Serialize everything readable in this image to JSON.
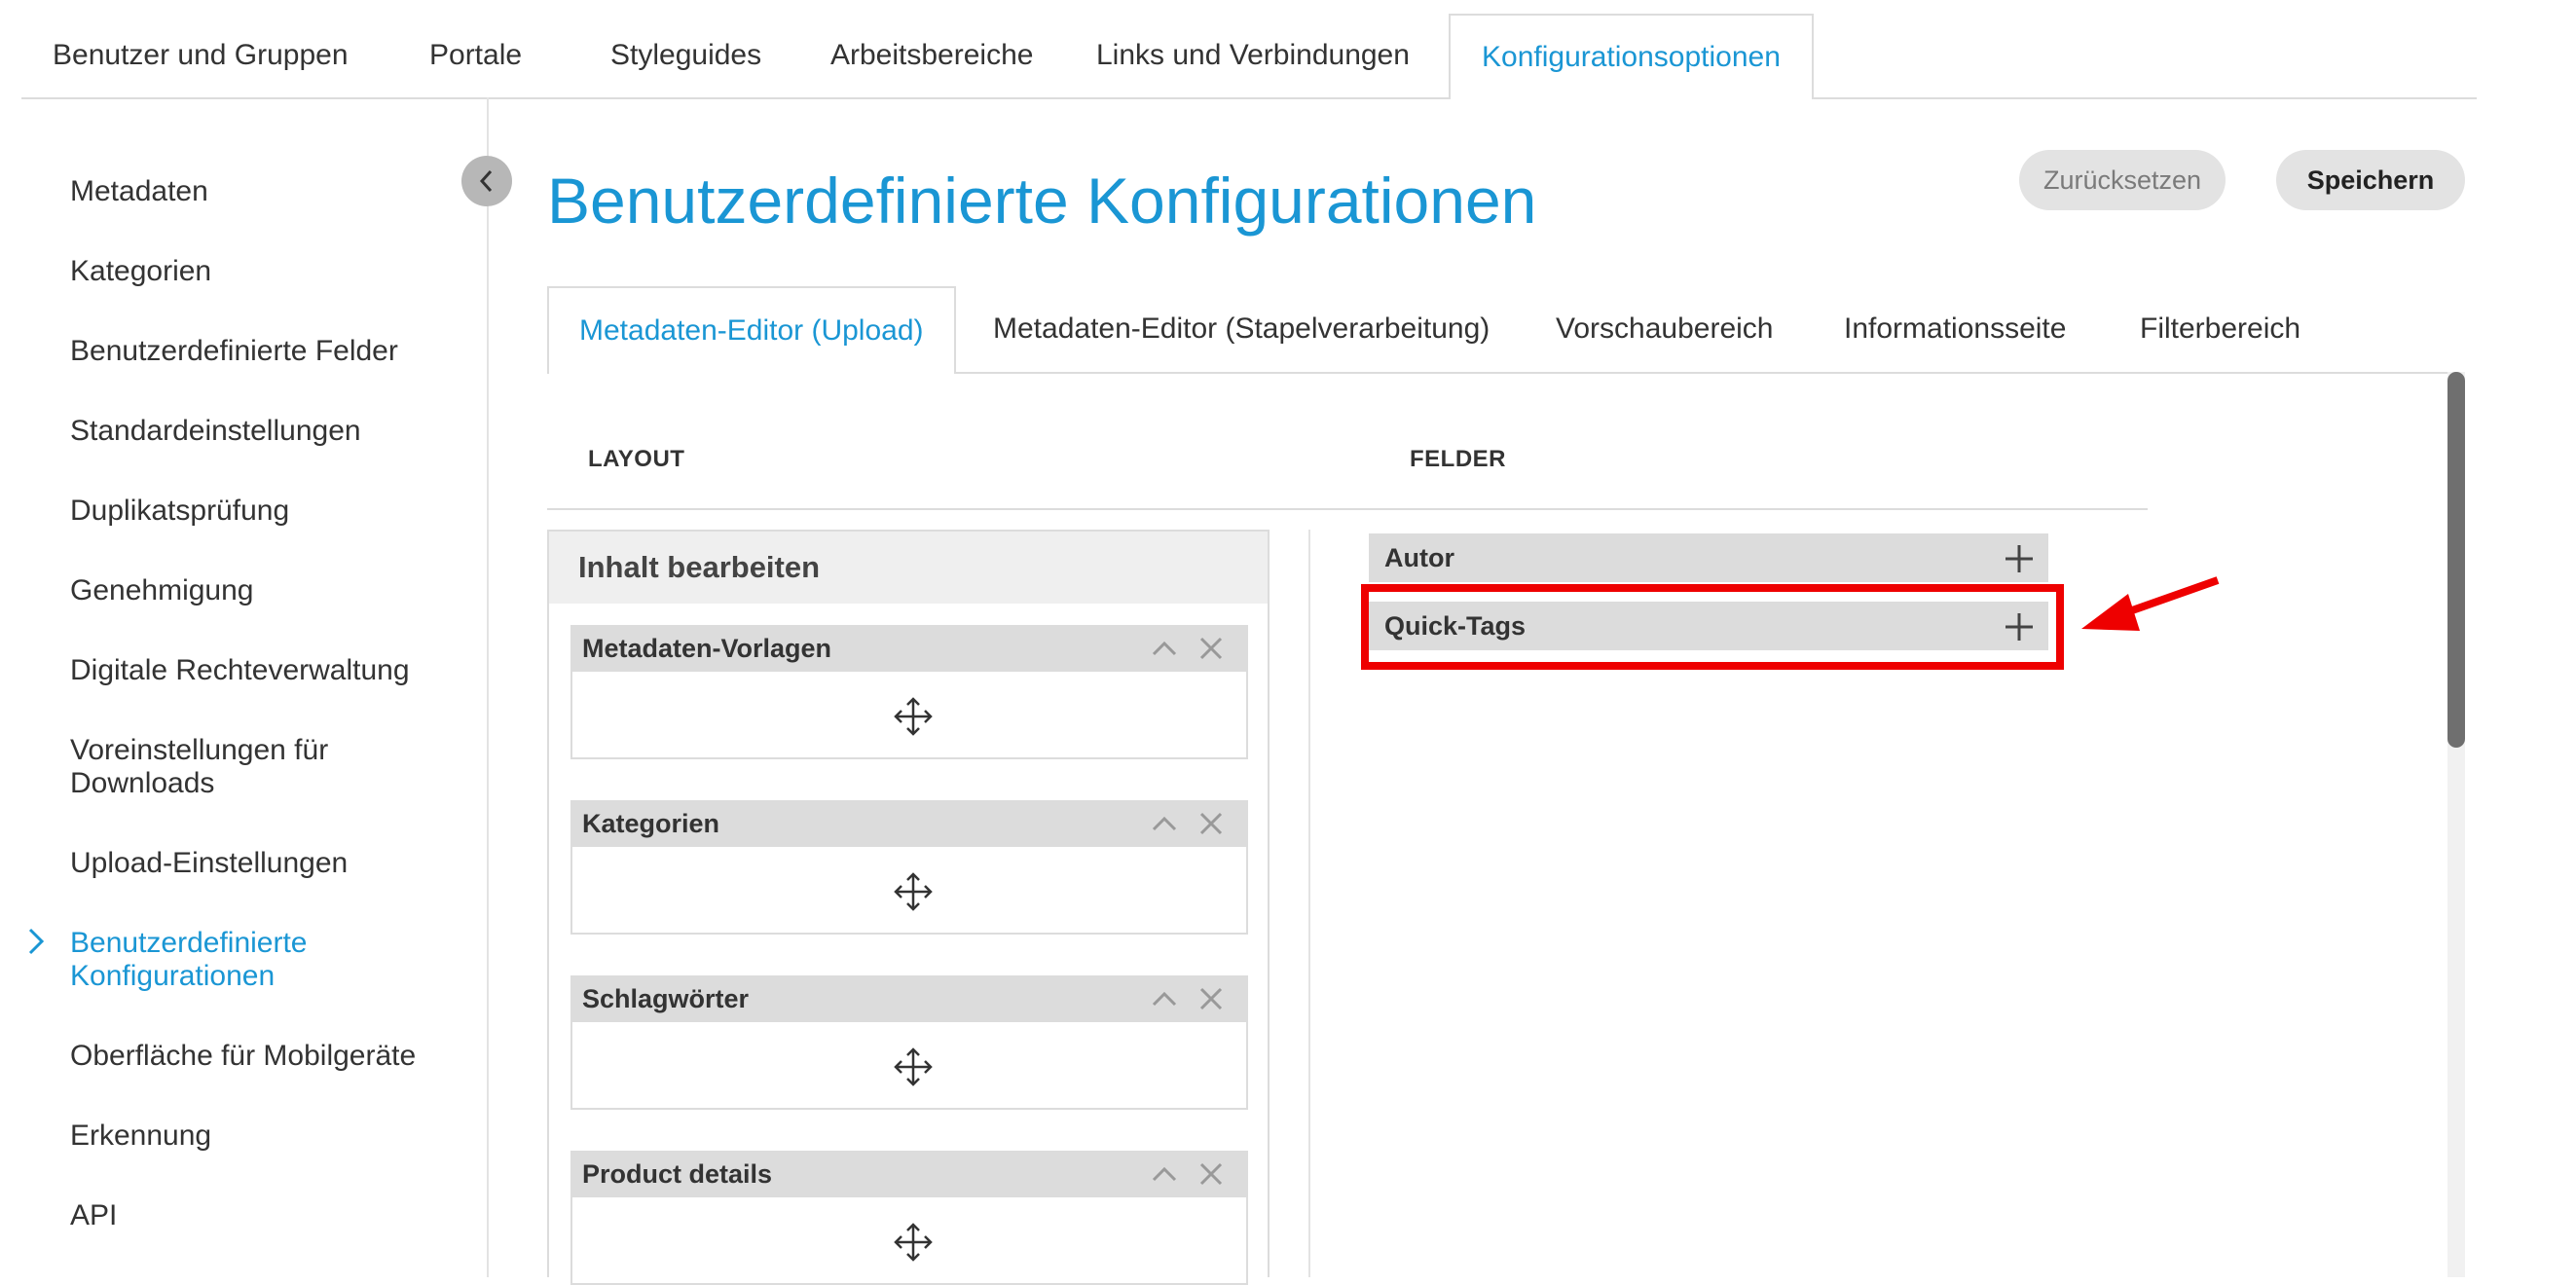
{
  "top_tabs": [
    {
      "label": "Benutzer und Gruppen"
    },
    {
      "label": "Portale"
    },
    {
      "label": "Styleguides"
    },
    {
      "label": "Arbeitsbereiche"
    },
    {
      "label": "Links und Verbindungen"
    },
    {
      "label": "Konfigurationsoptionen",
      "active": true
    }
  ],
  "sidebar": {
    "items": [
      {
        "label": "Metadaten"
      },
      {
        "label": "Kategorien"
      },
      {
        "label": "Benutzerdefinierte Felder"
      },
      {
        "label": "Standardeinstellungen"
      },
      {
        "label": "Duplikatsprüfung"
      },
      {
        "label": "Genehmigung"
      },
      {
        "label": "Digitale Rechteverwaltung"
      },
      {
        "label": "Voreinstellungen für Downloads"
      },
      {
        "label": "Upload-Einstellungen"
      },
      {
        "label": "Benutzerdefinierte Konfigurationen",
        "active": true
      },
      {
        "label": "Oberfläche für Mobilgeräte"
      },
      {
        "label": "Erkennung"
      },
      {
        "label": "API"
      }
    ]
  },
  "header": {
    "title": "Benutzerdefinierte Konfigurationen",
    "reset_label": "Zurücksetzen",
    "save_label": "Speichern"
  },
  "sub_tabs": [
    {
      "label": "Metadaten-Editor (Upload)",
      "active": true
    },
    {
      "label": "Metadaten-Editor (Stapelverarbeitung)"
    },
    {
      "label": "Vorschaubereich"
    },
    {
      "label": "Informationsseite"
    },
    {
      "label": "Filterbereich"
    }
  ],
  "layout": {
    "heading": "LAYOUT",
    "panel_title": "Inhalt bearbeiten",
    "blocks": [
      {
        "label": "Metadaten-Vorlagen"
      },
      {
        "label": "Kategorien"
      },
      {
        "label": "Schlagwörter"
      },
      {
        "label": "Product details"
      }
    ]
  },
  "fields": {
    "heading": "FELDER",
    "items": [
      {
        "label": "Autor"
      },
      {
        "label": "Quick-Tags",
        "highlighted": true
      }
    ]
  },
  "icons": {
    "collapse": "chevron-left-icon",
    "active_marker": "chevron-right-icon",
    "move": "move-icon",
    "collapse_block": "chevron-up-icon",
    "remove_block": "close-icon",
    "add_field": "plus-icon",
    "annotation": "arrow-icon"
  },
  "colors": {
    "accent": "#1a96d4",
    "highlight": "#ee0000",
    "panel_header": "#dcdcdc"
  }
}
